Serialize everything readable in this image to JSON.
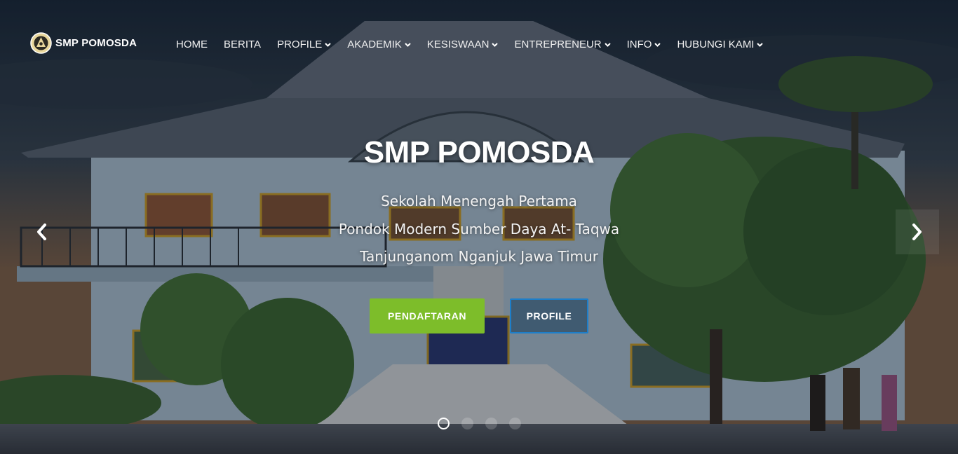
{
  "brand": {
    "name": "SMP POMOSDA",
    "logo_icon": "school-emblem-icon"
  },
  "nav": {
    "items": [
      {
        "label": "HOME",
        "dropdown": false
      },
      {
        "label": "BERITA",
        "dropdown": false
      },
      {
        "label": "PROFILE",
        "dropdown": true
      },
      {
        "label": "AKADEMIK",
        "dropdown": true
      },
      {
        "label": "KESISWAAN",
        "dropdown": true
      },
      {
        "label": "ENTREPRENEUR",
        "dropdown": true
      },
      {
        "label": "INFO",
        "dropdown": true
      },
      {
        "label": "HUBUNGI KAMI",
        "dropdown": true
      }
    ]
  },
  "hero": {
    "title": "SMP POMOSDA",
    "lines": [
      "Sekolah Menengah Pertama",
      "Pondok Modern Sumber Daya At- Taqwa",
      "Tanjunganom Nganjuk Jawa Timur"
    ],
    "buttons": {
      "primary": "PENDAFTARAN",
      "secondary": "PROFILE"
    }
  },
  "carousel": {
    "slide_count": 4,
    "active_slide": 1
  },
  "colors": {
    "primary_button": "#7dbd2a",
    "secondary_border": "#1d7ec9"
  }
}
